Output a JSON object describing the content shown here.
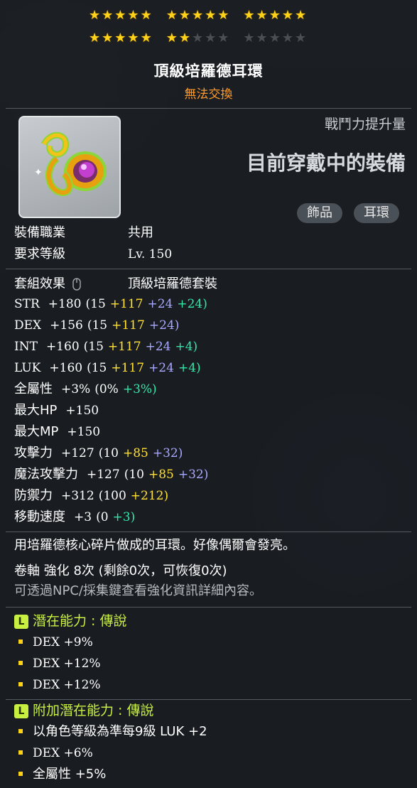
{
  "stars": {
    "groups": [
      {
        "filled": 5,
        "total": 5
      },
      {
        "filled": 5,
        "total": 5
      },
      {
        "filled": 5,
        "total": 5
      },
      {
        "filled": 5,
        "total": 5
      },
      {
        "filled": 2,
        "total": 5
      },
      {
        "filled": 0,
        "total": 5
      }
    ]
  },
  "item": {
    "name": "頂級培羅德耳環",
    "trade": "無法交換"
  },
  "header": {
    "power_label": "戰鬥力提升量",
    "equipped_label": "目前穿戴中的裝備",
    "tags": [
      "飾品",
      "耳環"
    ]
  },
  "requirements": {
    "job_label": "裝備職業",
    "job_value": "共用",
    "level_label": "要求等級",
    "level_value": "Lv. 150"
  },
  "set": {
    "label": "套組效果",
    "name": "頂級培羅德套裝"
  },
  "stats": [
    {
      "name": "STR",
      "total": "+180",
      "base": "(15",
      "p1": "+117",
      "p2": "+24",
      "p3": "+24)"
    },
    {
      "name": "DEX",
      "total": "+156",
      "base": "(15",
      "p1": "+117",
      "p2": "+24)",
      "p3": ""
    },
    {
      "name": "INT",
      "total": "+160",
      "base": "(15",
      "p1": "+117",
      "p2": "+24",
      "p3": "+4)"
    },
    {
      "name": "LUK",
      "total": "+160",
      "base": "(15",
      "p1": "+117",
      "p2": "+24",
      "p3": "+4)"
    },
    {
      "name": "全屬性",
      "total": "+3%",
      "base": "(0%",
      "p1": "",
      "p2": "",
      "p3": "+3%)"
    },
    {
      "name": "最大HP",
      "total": "+150",
      "base": "",
      "p1": "",
      "p2": "",
      "p3": ""
    },
    {
      "name": "最大MP",
      "total": "+150",
      "base": "",
      "p1": "",
      "p2": "",
      "p3": ""
    },
    {
      "name": "攻擊力",
      "total": "+127",
      "base": "(10",
      "p1": "+85",
      "p2": "+32)",
      "p3": ""
    },
    {
      "name": "魔法攻擊力",
      "total": "+127",
      "base": "(10",
      "p1": "+85",
      "p2": "+32)",
      "p3": ""
    },
    {
      "name": "防禦力",
      "total": "+312",
      "base": "(100",
      "p1": "+212)",
      "p2": "",
      "p3": ""
    },
    {
      "name": "移動速度",
      "total": "+3",
      "base": "(0",
      "p1": "",
      "p2": "",
      "p3": "+3)"
    }
  ],
  "description": "用培羅德核心碎片做成的耳環。好像偶爾會發亮。",
  "scroll": {
    "text": "卷軸 強化 8次 (剩餘0次，可恢復0次)",
    "hint": "可透過NPC/採集鍵查看強化資訊詳細內容。"
  },
  "potential": {
    "badge": "L",
    "title": "潛在能力 : 傳說",
    "lines": [
      "DEX +9%",
      "DEX +12%",
      "DEX +12%"
    ]
  },
  "bonus_potential": {
    "badge": "L",
    "title": "附加潛在能力 : 傳說",
    "lines": [
      "以角色等級為準每9級 LUK +2",
      "DEX +6%",
      "全屬性 +5%"
    ]
  },
  "colors": {
    "star": "#ffd21a",
    "trade": "#ff9a2a",
    "flame": "#ffe033",
    "star_force": "#a8a8ff",
    "bonus": "#33e7a8",
    "legendary": "#c8f040"
  }
}
